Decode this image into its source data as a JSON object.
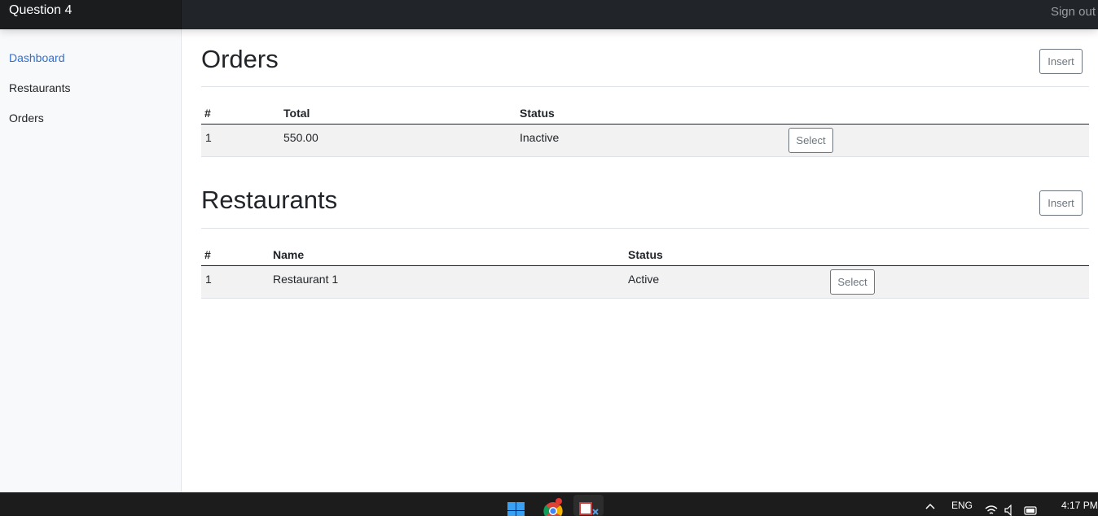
{
  "navbar": {
    "brand": "Question 4",
    "signout_label": "Sign out"
  },
  "sidebar": {
    "items": [
      {
        "label": "Dashboard",
        "active": true
      },
      {
        "label": "Restaurants",
        "active": false
      },
      {
        "label": "Orders",
        "active": false
      }
    ]
  },
  "orders": {
    "title": "Orders",
    "insert_label": "Insert",
    "headers": [
      "#",
      "Total",
      "Status"
    ],
    "rows": [
      {
        "id": "1",
        "total": "550.00",
        "status": "Inactive",
        "action": "Select"
      }
    ]
  },
  "restaurants": {
    "title": "Restaurants",
    "insert_label": "Insert",
    "headers": [
      "#",
      "Name",
      "Status"
    ],
    "rows": [
      {
        "id": "1",
        "name": "Restaurant 1",
        "status": "Active",
        "action": "Select"
      }
    ]
  },
  "taskbar": {
    "icons": [
      "windows-start-icon",
      "chrome-icon",
      "snipping-tool-icon"
    ],
    "tray": {
      "language": "ENG",
      "time": "4:17 PM"
    },
    "colors": {
      "accent": "#2f6fd1",
      "navbar": "#212529"
    }
  }
}
